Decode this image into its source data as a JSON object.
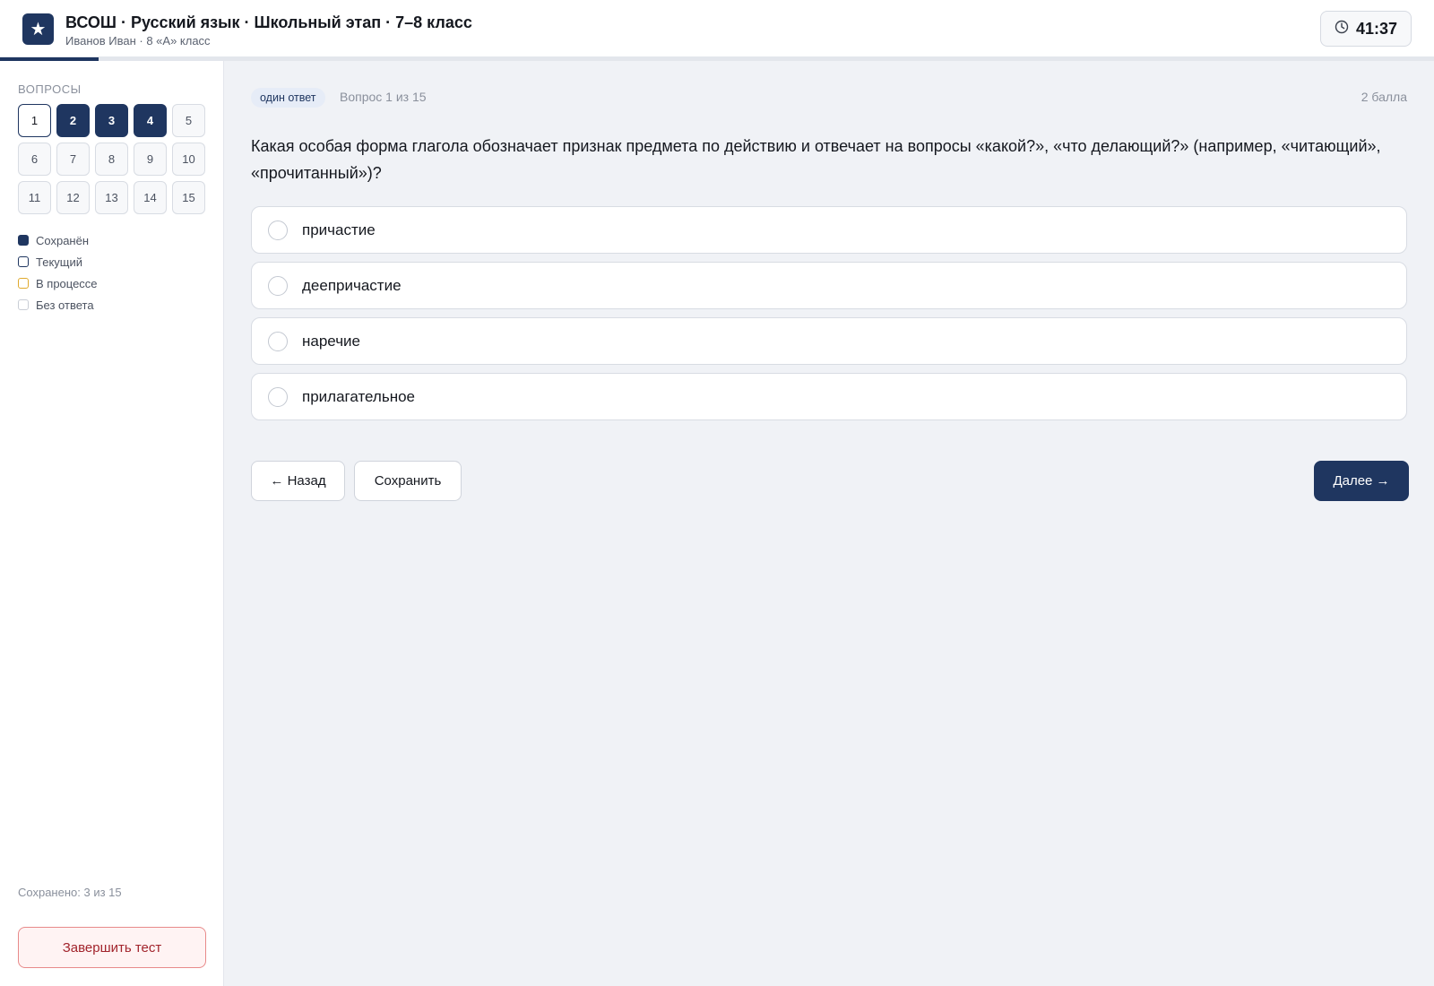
{
  "header": {
    "logo_glyph": "★",
    "title": "ВСОШ · Русский язык · Школьный этап · 7–8 класс",
    "subtitle": "Иванов Иван · 8 «А» класс",
    "timer": "41:37",
    "progress_fraction": 0.069
  },
  "sidebar": {
    "heading": "Вопросы",
    "questions": [
      {
        "num": "1",
        "state": "current"
      },
      {
        "num": "2",
        "state": "saved"
      },
      {
        "num": "3",
        "state": "saved"
      },
      {
        "num": "4",
        "state": "saved"
      },
      {
        "num": "5",
        "state": "none"
      },
      {
        "num": "6",
        "state": "none"
      },
      {
        "num": "7",
        "state": "none"
      },
      {
        "num": "8",
        "state": "none"
      },
      {
        "num": "9",
        "state": "none"
      },
      {
        "num": "10",
        "state": "none"
      },
      {
        "num": "11",
        "state": "none"
      },
      {
        "num": "12",
        "state": "none"
      },
      {
        "num": "13",
        "state": "none"
      },
      {
        "num": "14",
        "state": "none"
      },
      {
        "num": "15",
        "state": "none"
      }
    ],
    "legend": {
      "saved": "Сохранён",
      "current": "Текущий",
      "in_progress": "В процессе",
      "no_answer": "Без ответа"
    },
    "saved_count": "Сохранено: 3 из 15",
    "finish_label": "Завершить тест"
  },
  "question": {
    "type_badge": "один ответ",
    "counter": "Вопрос 1 из 15",
    "points": "2 балла",
    "text": "Какая особая форма глагола обозначает признак предмета по действию и отвечает на вопросы «какой?», «что делающий?» (например, «читающий», «прочитанный»)?",
    "options": [
      "причастие",
      "деепричастие",
      "наречие",
      "прилагательное"
    ]
  },
  "nav": {
    "back_label": "← Назад",
    "save_label": "Сохранить",
    "next_label": "Далее →"
  },
  "colors": {
    "accent": "#1f3660",
    "in_progress": "#e0a92c",
    "danger": "#a2242c"
  },
  "icons": {
    "logo": "star-icon",
    "timer": "clock-icon"
  }
}
